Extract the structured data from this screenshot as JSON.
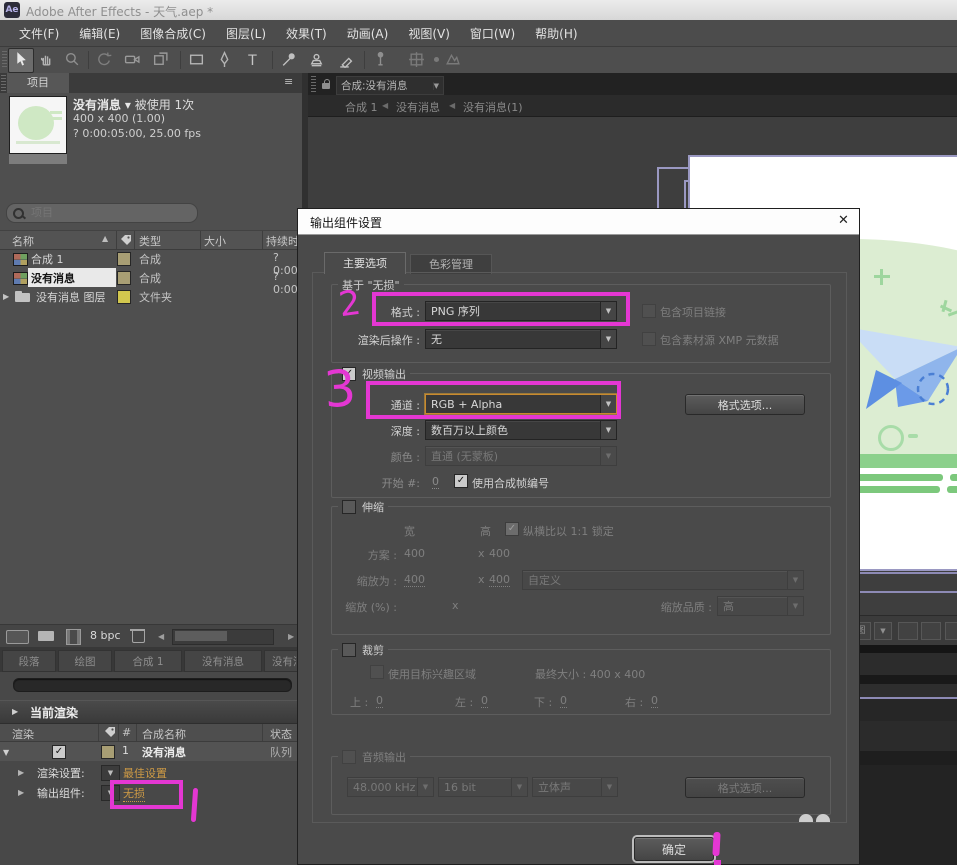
{
  "window": {
    "title": "Adobe After Effects - 天气.aep *",
    "logo": "Ae"
  },
  "menu": {
    "items": [
      "文件(F)",
      "编辑(E)",
      "图像合成(C)",
      "图层(L)",
      "效果(T)",
      "动画(A)",
      "视图(V)",
      "窗口(W)",
      "帮助(H)"
    ]
  },
  "icons": {
    "dropdown": "▼",
    "sort": "▲",
    "check": "✓",
    "tri_open": "▼",
    "tri_closed": "▶",
    "panel_menu": "≡",
    "prev": "◀",
    "next": "▶",
    "crumb": "◀",
    "close": "✕",
    "pic": "图"
  },
  "project": {
    "tab_label": "项目",
    "preview": {
      "name": "没有消息",
      "caret": "▾",
      "usage": "被使用 1次",
      "size": "400 x 400 (1.00)",
      "duration": "? 0:00:05:00, 25.00 fps"
    },
    "columns": {
      "name": "名称",
      "type": "类型",
      "size": "大小",
      "duration": "持续时"
    },
    "rows": [
      {
        "name": "合成 1",
        "type": "合成",
        "duration": "?0:00"
      },
      {
        "name": "没有消息",
        "type": "合成",
        "duration": "?0:00"
      },
      {
        "name": "没有消息 图层",
        "type": "文件夹",
        "duration": ""
      }
    ],
    "footer": {
      "bpc": "8 bpc"
    }
  },
  "timeline_tabs": [
    "段落",
    "绘图",
    "合成 1",
    "没有消息",
    "没有消息"
  ],
  "render_queue": {
    "header": "当前渲染",
    "columns": {
      "render": "渲染",
      "num": "#",
      "comp": "合成名称",
      "status": "状态"
    },
    "row": {
      "num": "1",
      "comp": "没有消息",
      "status": "队列"
    },
    "settings": {
      "label": "渲染设置:",
      "value": "最佳设置"
    },
    "module": {
      "label": "输出组件:",
      "value": "无损"
    }
  },
  "comp_panel": {
    "tab_label": "合成:没有消息",
    "breadcrumb": [
      "合成 1",
      "没有消息",
      "没有消息(1)"
    ]
  },
  "dialog": {
    "title": "输出组件设置",
    "tabs": [
      "主要选项",
      "色彩管理"
    ],
    "base": {
      "legend": "基于 \"无损\"",
      "format_label": "格式 :",
      "format_value": "PNG 序列",
      "post_label": "渲染后操作 :",
      "post_value": "无",
      "include_project_link": "包含项目链接",
      "include_xmp": "包含素材源 XMP 元数据"
    },
    "video": {
      "legend": "视频输出",
      "channel_label": "通道 :",
      "channel_value": "RGB + Alpha",
      "depth_label": "深度 :",
      "depth_value": "数百万以上颜色",
      "color_label": "颜色 :",
      "color_value": "直通 (无蒙板)",
      "start_label": "开始 #:",
      "start_value": "0",
      "frame_number_label": "使用合成帧编号",
      "format_options_label": "格式选项..."
    },
    "stretch": {
      "legend": "伸缩",
      "width_header": "宽",
      "height_header": "高",
      "lock_label": "纵横比以 1:1 锁定",
      "scheme_label": "方案 :",
      "scheme_width": "400",
      "mult": "x",
      "scheme_height": "400",
      "scale_label": "缩放为 :",
      "scale_width": "400",
      "scale_height": "400",
      "preset": "自定义",
      "percent_label": "缩放 (%) :",
      "quality_label": "缩放品质 :",
      "quality_value": "高"
    },
    "crop": {
      "legend": "裁剪",
      "roi_label": "使用目标兴趣区域",
      "final_label": "最终大小 : 400 x 400",
      "top_label": "上 :",
      "top_value": "0",
      "left_label": "左 :",
      "left_value": "0",
      "bottom_label": "下 :",
      "bottom_value": "0",
      "right_label": "右 :",
      "right_value": "0"
    },
    "audio": {
      "legend": "音频输出",
      "rate": "48.000 kHz",
      "bit_depth": "16 bit",
      "channels": "立体声",
      "format_options_label": "格式选项..."
    },
    "ok_label": "确定"
  },
  "annotations": {
    "step2": "2",
    "step3": "3"
  },
  "colors": {
    "annotation": "#e437d3",
    "link": "#cf9b45",
    "focus_border": "#c98a2e",
    "panel_edge": "#8d8ab5"
  }
}
